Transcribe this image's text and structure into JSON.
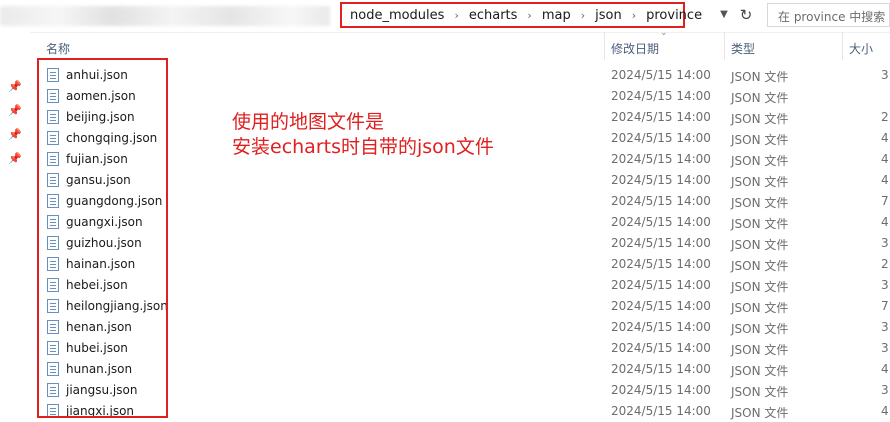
{
  "address_bar": {
    "crumbs": [
      "node_modules",
      "echarts",
      "map",
      "json",
      "province"
    ],
    "separator": "›",
    "dropdown_icon": "chevron-down-icon",
    "refresh_icon": "refresh-icon",
    "search_placeholder": "在 province 中搜索"
  },
  "columns": {
    "name": "名称",
    "date": "修改日期",
    "type": "类型",
    "size": "大小"
  },
  "files": [
    {
      "name": "anhui.json",
      "date": "2024/5/15 14:00",
      "type": "JSON 文件",
      "size": "3"
    },
    {
      "name": "aomen.json",
      "date": "2024/5/15 14:00",
      "type": "JSON 文件",
      "size": ""
    },
    {
      "name": "beijing.json",
      "date": "2024/5/15 14:00",
      "type": "JSON 文件",
      "size": "2"
    },
    {
      "name": "chongqing.json",
      "date": "2024/5/15 14:00",
      "type": "JSON 文件",
      "size": "4"
    },
    {
      "name": "fujian.json",
      "date": "2024/5/15 14:00",
      "type": "JSON 文件",
      "size": "4"
    },
    {
      "name": "gansu.json",
      "date": "2024/5/15 14:00",
      "type": "JSON 文件",
      "size": "4"
    },
    {
      "name": "guangdong.json",
      "date": "2024/5/15 14:00",
      "type": "JSON 文件",
      "size": "7"
    },
    {
      "name": "guangxi.json",
      "date": "2024/5/15 14:00",
      "type": "JSON 文件",
      "size": "4"
    },
    {
      "name": "guizhou.json",
      "date": "2024/5/15 14:00",
      "type": "JSON 文件",
      "size": "3"
    },
    {
      "name": "hainan.json",
      "date": "2024/5/15 14:00",
      "type": "JSON 文件",
      "size": "2"
    },
    {
      "name": "hebei.json",
      "date": "2024/5/15 14:00",
      "type": "JSON 文件",
      "size": "3"
    },
    {
      "name": "heilongjiang.json",
      "date": "2024/5/15 14:00",
      "type": "JSON 文件",
      "size": "7"
    },
    {
      "name": "henan.json",
      "date": "2024/5/15 14:00",
      "type": "JSON 文件",
      "size": "3"
    },
    {
      "name": "hubei.json",
      "date": "2024/5/15 14:00",
      "type": "JSON 文件",
      "size": "3"
    },
    {
      "name": "hunan.json",
      "date": "2024/5/15 14:00",
      "type": "JSON 文件",
      "size": "4"
    },
    {
      "name": "jiangsu.json",
      "date": "2024/5/15 14:00",
      "type": "JSON 文件",
      "size": "3"
    },
    {
      "name": "jiangxi.json",
      "date": "2024/5/15 14:00",
      "type": "JSON 文件",
      "size": "4"
    }
  ],
  "quick_access_pins": [
    "pin-icon",
    "pin-icon",
    "pin-icon",
    "pin-icon"
  ],
  "annotation": {
    "line1": "使用的地图文件是",
    "line2": "安装echarts时自带的json文件"
  },
  "colors": {
    "highlight": "#e02020",
    "header_text": "#4c607a",
    "secondary_text": "#6d6d6d"
  }
}
